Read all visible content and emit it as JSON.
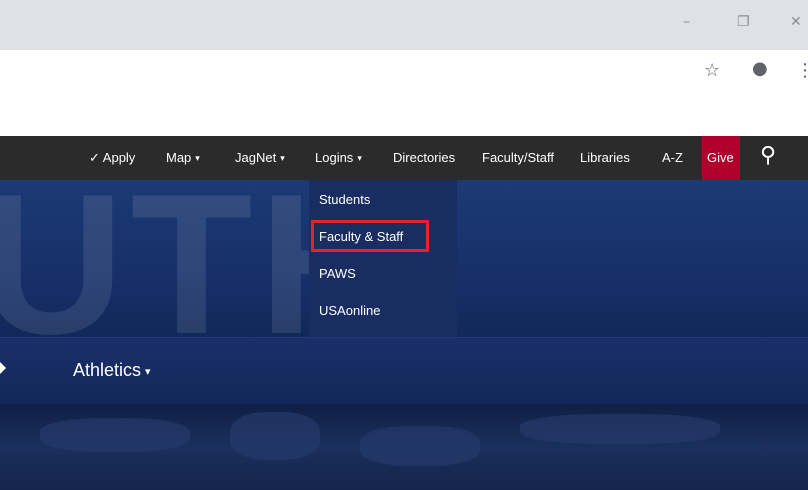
{
  "browser": {
    "window_controls": {
      "minimize": "–",
      "restore": "❐",
      "close": "✕"
    },
    "toolbar_icons": {
      "bookmark": "☆",
      "profile": "●",
      "menu": "⋮"
    }
  },
  "utility_nav": {
    "items": [
      {
        "label": "✓ Apply"
      },
      {
        "label": "Map"
      },
      {
        "label": "JagNet"
      },
      {
        "label": "Logins"
      },
      {
        "label": "Directories"
      },
      {
        "label": "Faculty/Staff"
      },
      {
        "label": "Libraries"
      },
      {
        "label": "A-Z"
      },
      {
        "label": "Give"
      }
    ],
    "dropdown_caret": "▾",
    "search_icon": "⚲"
  },
  "logins_dropdown": {
    "items": [
      {
        "label": "Students"
      },
      {
        "label": "Faculty & Staff"
      },
      {
        "label": "PAWS"
      },
      {
        "label": "USAonline"
      }
    ]
  },
  "hero": {
    "background_letters": "UTH"
  },
  "main_nav": {
    "items": [
      {
        "label": "Athletics"
      }
    ]
  },
  "colors": {
    "utility_bar": "#2b2b2b",
    "give_button": "#b2002d",
    "navy": "#17306a",
    "highlight_border": "#e2232a"
  }
}
